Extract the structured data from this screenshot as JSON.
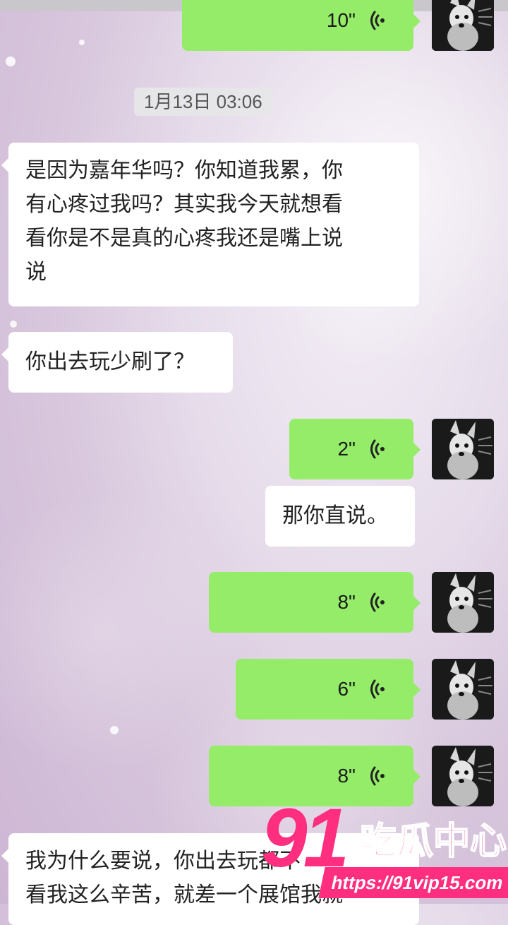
{
  "chat": {
    "timestamp": "1月13日 03:06",
    "messages": [
      {
        "type": "voice",
        "side": "right",
        "duration": "10\""
      },
      {
        "type": "text",
        "side": "left",
        "text": "是因为嘉年华吗？你知道我累，你有心疼过我吗？其实我今天就想看看你是不是真的心疼我还是嘴上说说"
      },
      {
        "type": "text",
        "side": "left",
        "text": "你出去玩少刷了？"
      },
      {
        "type": "voice",
        "side": "right",
        "duration": "2\""
      },
      {
        "type": "text",
        "side": "right",
        "text": "那你直说。"
      },
      {
        "type": "voice",
        "side": "right",
        "duration": "8\""
      },
      {
        "type": "voice",
        "side": "right",
        "duration": "6\""
      },
      {
        "type": "voice",
        "side": "right",
        "duration": "8\""
      },
      {
        "type": "text",
        "side": "left",
        "text": "我为什么要说，你出去玩都不看我这么辛苦，就差一个展馆我就"
      }
    ],
    "lines": {
      "m1": [
        "是因为嘉年华吗？你知道我累，你",
        "有心疼过我吗？其实我今天就想看",
        "看你是不是真的心疼我还是嘴上说",
        "说"
      ],
      "m8": [
        "我为什么要说，你出去玩都不",
        "看我这么辛苦，就差一个展馆我就"
      ]
    }
  },
  "watermark": {
    "number": "91",
    "title": "吃瓜中心",
    "url": "https://91vip15.com"
  },
  "colors": {
    "green_bubble": "#95ec69",
    "white_bubble": "#ffffff",
    "watermark": "#ff2e7e"
  },
  "icons": [
    "voice-wave-icon",
    "dog-avatar"
  ]
}
